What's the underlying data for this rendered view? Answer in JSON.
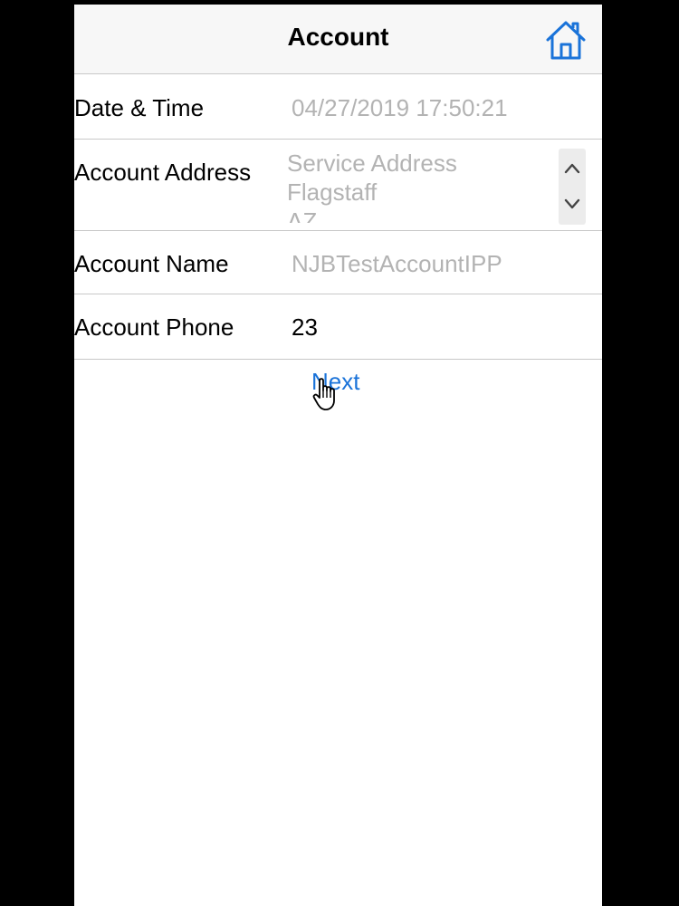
{
  "header": {
    "title": "Account",
    "home_icon": "home-icon"
  },
  "fields": {
    "datetime": {
      "label": "Date & Time",
      "value": "04/27/2019 17:50:21"
    },
    "address": {
      "label": "Account Address",
      "lines": [
        "Service Address",
        "Flagstaff",
        "AZ"
      ]
    },
    "name": {
      "label": "Account Name",
      "value": "NJBTestAccountIPP"
    },
    "phone": {
      "label": "Account Phone",
      "value": "23"
    }
  },
  "actions": {
    "next_label": "Next"
  },
  "colors": {
    "accent": "#1a73d9",
    "placeholder": "#b3b3b3"
  }
}
